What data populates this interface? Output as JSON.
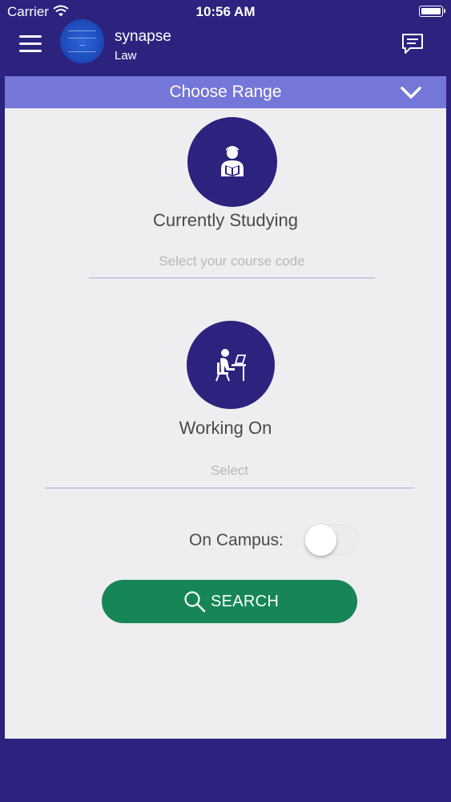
{
  "status_bar": {
    "carrier": "Carrier",
    "time": "10:56 AM"
  },
  "nav": {
    "title": "synapse",
    "subtitle": "Law"
  },
  "range": {
    "title": "Choose Range"
  },
  "studying": {
    "label": "Currently Studying",
    "placeholder": "Select your course code",
    "value": ""
  },
  "working": {
    "label": "Working On",
    "placeholder": "Select",
    "value": ""
  },
  "campus": {
    "label": "On Campus:",
    "enabled": false
  },
  "search": {
    "label": "SEARCH"
  },
  "colors": {
    "primary": "#2c237f",
    "header": "#7476d8",
    "button": "#168657",
    "panel": "#eeeef0"
  },
  "icons": {
    "menu": "hamburger-icon",
    "chat": "chat-bubble-icon",
    "range_toggle": "chevron-down-icon",
    "studying": "student-reading-icon",
    "working": "person-at-desk-icon",
    "search": "magnifier-icon"
  }
}
